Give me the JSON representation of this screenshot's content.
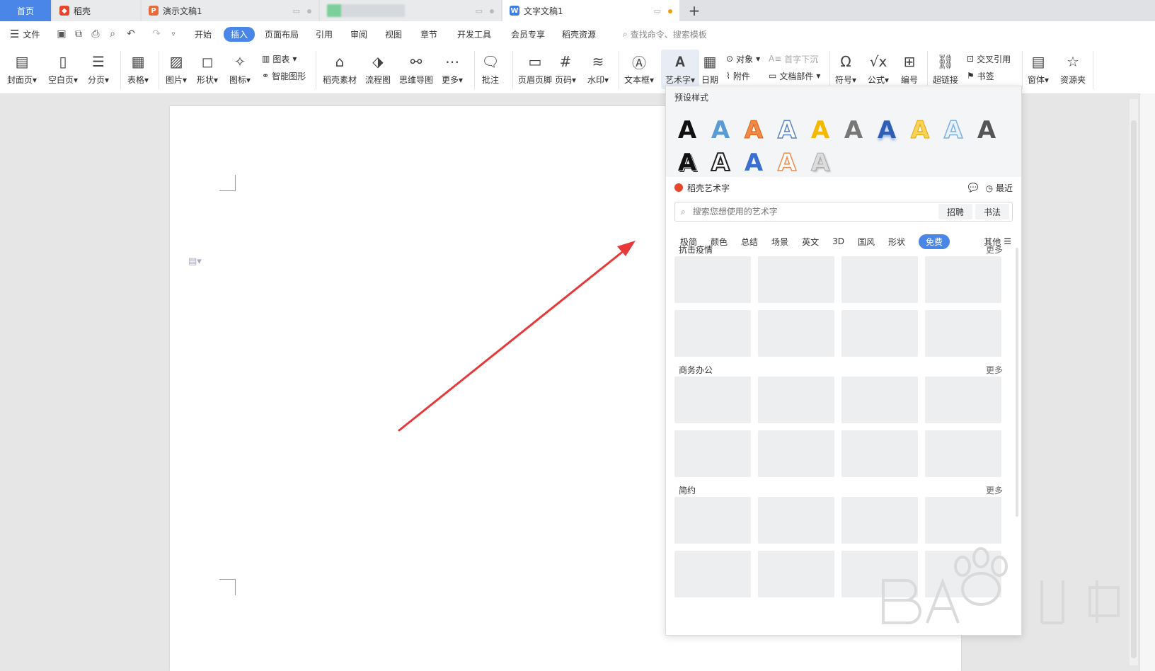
{
  "tabs": {
    "home": "首页",
    "daoke": "稻壳",
    "ppt": "演示文稿1",
    "doc": "文字文稿1",
    "add": "+"
  },
  "menu": {
    "file": "文件",
    "items": [
      "开始",
      "插入",
      "页面布局",
      "引用",
      "审阅",
      "视图",
      "章节",
      "开发工具",
      "会员专享",
      "稻壳资源"
    ],
    "active": "插入",
    "search": "查找命令、搜索模板"
  },
  "ribbon": {
    "cover": "封面页",
    "blank": "空白页",
    "pagebreak": "分页",
    "table": "表格",
    "picture": "图片",
    "shape": "形状",
    "icon": "图标",
    "chart": "图表",
    "smartart": "智能图形",
    "material": "稻壳素材",
    "flowchart": "流程图",
    "mindmap": "思维导图",
    "more": "更多",
    "comment": "批注",
    "headerfooter": "页眉页脚",
    "pagenum": "页码",
    "watermark": "水印",
    "textbox": "文本框",
    "wordart": "艺术字",
    "date": "日期",
    "object": "对象",
    "attachment": "附件",
    "dropcap": "首字下沉",
    "docpart": "文档部件",
    "symbol": "符号",
    "formula": "公式",
    "numbering": "编号",
    "crossref": "交叉引用",
    "hyperlink": "超链接",
    "bookmark": "书签",
    "window": "窗体",
    "resource": "资源夹"
  },
  "wordart_panel": {
    "preset_title": "预设样式",
    "brand": "稻壳艺术字",
    "recent": "最近",
    "search_placeholder": "搜索您想使用的艺术字",
    "tag1": "招聘",
    "tag2": "书法",
    "categories": [
      "极简",
      "颜色",
      "总结",
      "场景",
      "英文",
      "3D",
      "国风",
      "形状",
      "免费"
    ],
    "active_category": "免费",
    "other": "其他",
    "sections": [
      {
        "title": "抗击疫情",
        "more": "更多"
      },
      {
        "title": "商务办公",
        "more": "更多"
      },
      {
        "title": "简约",
        "more": "更多"
      }
    ],
    "preset_glyph": "A"
  },
  "colors": {
    "accent": "#4a86e8",
    "arrow": "#e8393a"
  }
}
